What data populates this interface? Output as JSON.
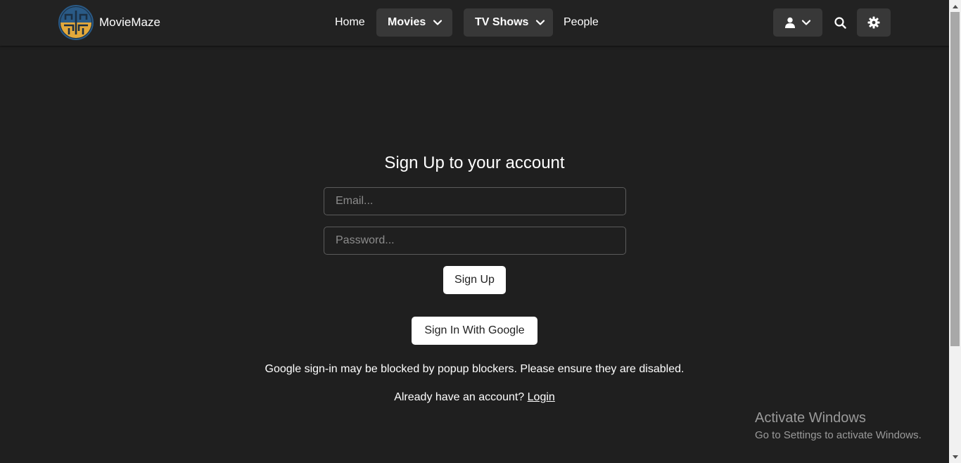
{
  "brand": {
    "name": "MovieMaze",
    "logo_icon": "moviemaze-logo-icon"
  },
  "nav": {
    "home": "Home",
    "movies": "Movies",
    "tv_shows": "TV Shows",
    "people": "People"
  },
  "header_icons": [
    "user-icon",
    "chevron-down-icon",
    "search-icon",
    "gear-icon"
  ],
  "form": {
    "title": "Sign Up to your account",
    "email_placeholder": "Email...",
    "password_placeholder": "Password...",
    "signup_label": "Sign Up",
    "google_label": "Sign In With Google",
    "popup_note": "Google sign-in may be blocked by popup blockers. Please ensure they are disabled.",
    "already_text": "Already have an account?",
    "login_label": "Login"
  },
  "watermark": {
    "title": "Activate Windows",
    "subtitle": "Go to Settings to activate Windows."
  },
  "colors": {
    "background": "#1f1f1f",
    "navbar": "#222222",
    "button_dark": "#383838",
    "button_light": "#ffffff",
    "logo_blue": "#2a5a86",
    "logo_gold": "#e3a93b"
  }
}
